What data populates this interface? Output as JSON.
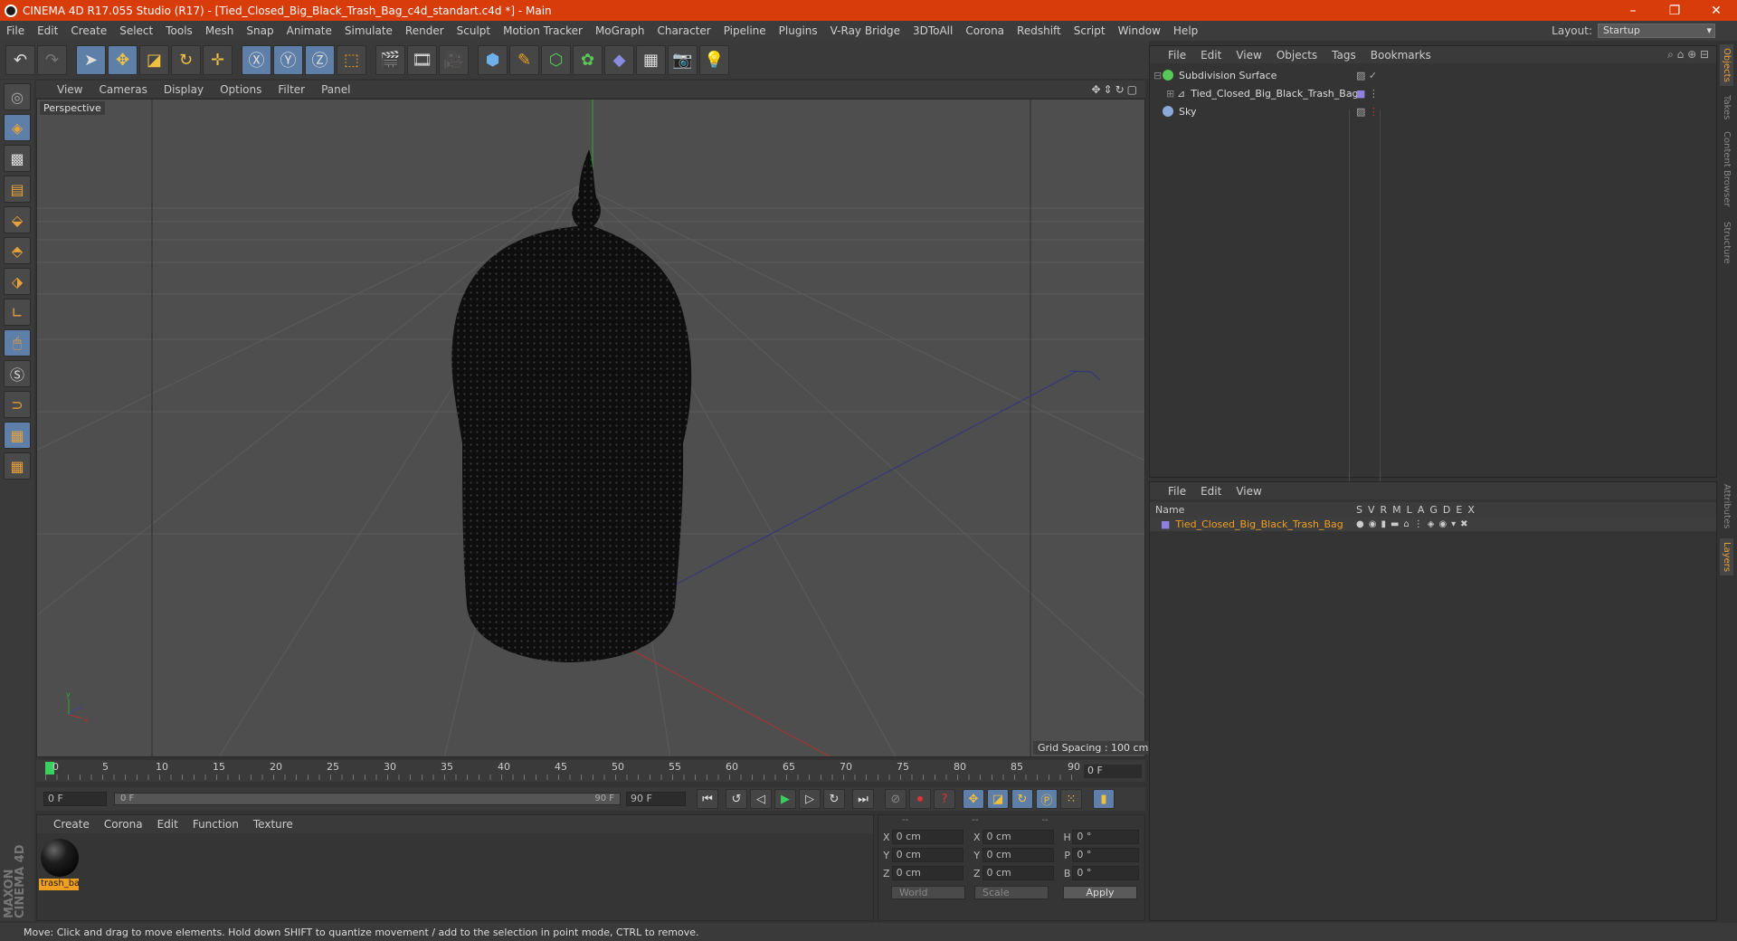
{
  "window": {
    "title": "CINEMA 4D R17.055 Studio (R17) - [Tied_Closed_Big_Black_Trash_Bag_c4d_standart.c4d *] - Main"
  },
  "menu": [
    "File",
    "Edit",
    "Create",
    "Select",
    "Tools",
    "Mesh",
    "Snap",
    "Animate",
    "Simulate",
    "Render",
    "Sculpt",
    "Motion Tracker",
    "MoGraph",
    "Character",
    "Pipeline",
    "Plugins",
    "V-Ray Bridge",
    "3DToAll",
    "Corona",
    "Redshift",
    "Script",
    "Window",
    "Help"
  ],
  "layout": {
    "label": "Layout:",
    "value": "Startup"
  },
  "viewport": {
    "menu": [
      "View",
      "Cameras",
      "Display",
      "Options",
      "Filter",
      "Panel"
    ],
    "label": "Perspective",
    "grid_spacing": "Grid Spacing : 100 cm"
  },
  "timeline": {
    "ticks": [
      "0",
      "5",
      "10",
      "15",
      "20",
      "25",
      "30",
      "35",
      "40",
      "45",
      "50",
      "55",
      "60",
      "65",
      "70",
      "75",
      "80",
      "85",
      "90"
    ],
    "current_frame": "0 F",
    "start_field": "0 F",
    "slider_left": "0 F",
    "slider_right": "90 F",
    "end_field": "90 F"
  },
  "material_panel": {
    "menu": [
      "Create",
      "Corona",
      "Edit",
      "Function",
      "Texture"
    ],
    "material_name": "trash_ba"
  },
  "coords": {
    "headers": [
      "--",
      "--",
      "--"
    ],
    "rows": [
      {
        "a": "X",
        "av": "0 cm",
        "b": "X",
        "bv": "0 cm",
        "c": "H",
        "cv": "0 °"
      },
      {
        "a": "Y",
        "av": "0 cm",
        "b": "Y",
        "bv": "0 cm",
        "c": "P",
        "cv": "0 °"
      },
      {
        "a": "Z",
        "av": "0 cm",
        "b": "Z",
        "bv": "0 cm",
        "c": "B",
        "cv": "0 °"
      }
    ],
    "mode1": "World",
    "mode2": "Scale",
    "apply": "Apply"
  },
  "objects_panel": {
    "menu": [
      "File",
      "Edit",
      "View",
      "Objects",
      "Tags",
      "Bookmarks"
    ],
    "items": [
      "Subdivision Surface",
      "Tied_Closed_Big_Black_Trash_Bag",
      "Sky"
    ]
  },
  "layers_panel": {
    "menu": [
      "File",
      "Edit",
      "View"
    ],
    "header_name": "Name",
    "cols": [
      "S",
      "V",
      "R",
      "M",
      "L",
      "A",
      "G",
      "D",
      "E",
      "X"
    ],
    "layer": "Tied_Closed_Big_Black_Trash_Bag"
  },
  "side_tabs": [
    "Objects",
    "Takes",
    "Content Browser",
    "Structure",
    "Attributes",
    "Layers"
  ],
  "status": "Move: Click and drag to move elements. Hold down SHIFT to quantize movement / add to the selection in point mode, CTRL to remove.",
  "brand": "MAXON CINEMA 4D"
}
